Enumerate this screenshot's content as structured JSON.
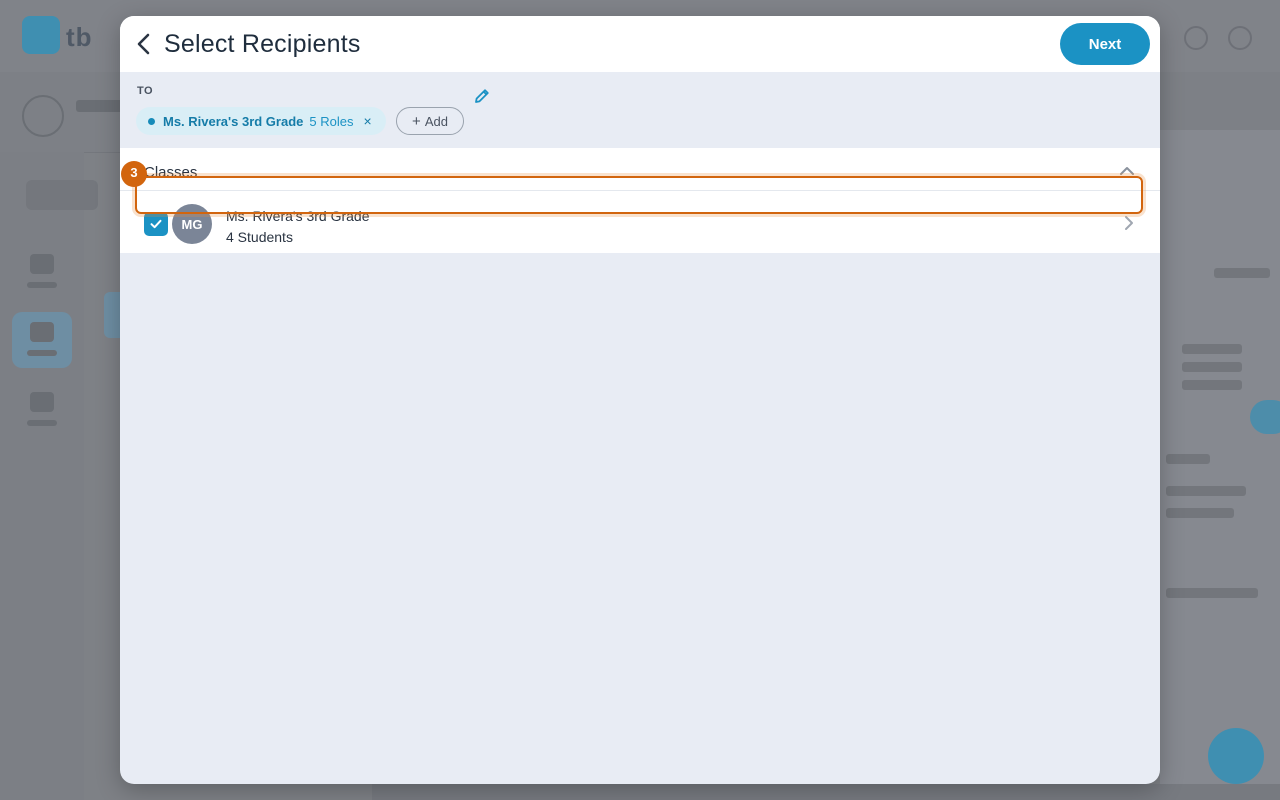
{
  "background": {
    "logo_text": "tb"
  },
  "modal": {
    "title": "Select Recipients",
    "next_label": "Next",
    "to_label": "TO",
    "chip": {
      "name": "Ms. Rivera's 3rd Grade",
      "roles": "5 Roles",
      "remove_glyph": "×"
    },
    "add_label": "Add",
    "add_glyph": "+",
    "section": {
      "title": "Classes",
      "rows": [
        {
          "initials": "MG",
          "name": "Ms. Rivera's 3rd Grade",
          "subtitle": "4 Students",
          "checked": true
        }
      ]
    }
  },
  "annotation": {
    "step_number": "3"
  },
  "colors": {
    "accent": "#1b92c4",
    "annotation": "#d2650e",
    "avatar": "#7b8597"
  },
  "icons": {
    "back": "chevron-left-icon",
    "edit": "pencil-icon",
    "remove": "close-icon",
    "add": "plus-icon",
    "collapse": "chevron-up-icon",
    "check": "check-icon",
    "row_nav": "chevron-right-icon"
  }
}
